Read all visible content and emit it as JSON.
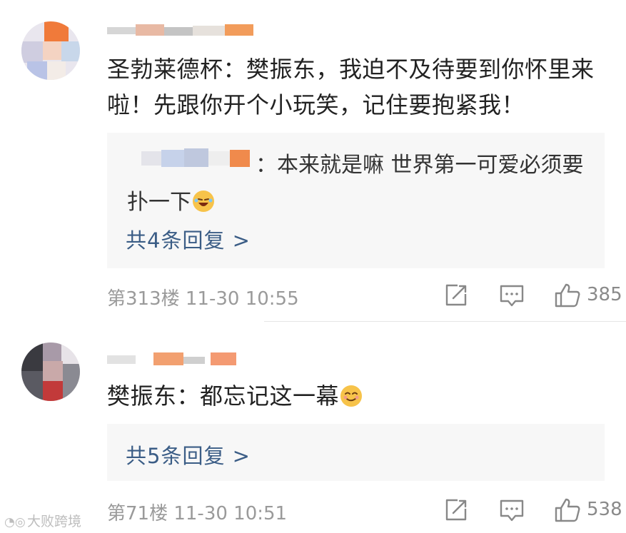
{
  "comments": [
    {
      "text": "圣勃莱德杯：樊振东，我迫不及待要到你怀里来啦！先跟你开个小玩笑，记住要抱紧我！",
      "reply": {
        "colon": "：",
        "text": "本来就是嘛 世界第一可爱必须要扑一下",
        "emoji": "crying-laughing-emoji"
      },
      "more_replies": "共4条回复 >",
      "meta": "第313楼 11-30 10:55",
      "likes": "385"
    },
    {
      "text": "樊振东：都忘记这一幕",
      "emoji": "smirk-emoji",
      "more_replies": "共5条回复 >",
      "meta": "第71楼 11-30 10:51",
      "likes": "538"
    }
  ],
  "watermark": "大败跨境",
  "colors": {
    "panel_bg": "#f7f7f7",
    "link": "#3b5d86",
    "meta": "#9a9a9a",
    "text": "#222222"
  }
}
